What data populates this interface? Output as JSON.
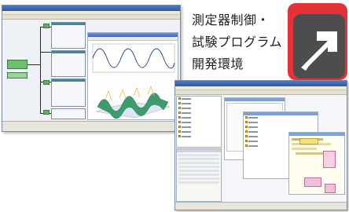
{
  "caption": {
    "line1": "測定器制御・",
    "line2": "試験プログラム",
    "line3": "開発環境"
  },
  "icons": {
    "logo": "arrow-up-right-icon"
  },
  "colors": {
    "logo_red": "#e53238",
    "logo_gray": "#4d4d4d",
    "arrow": "#ffffff"
  }
}
